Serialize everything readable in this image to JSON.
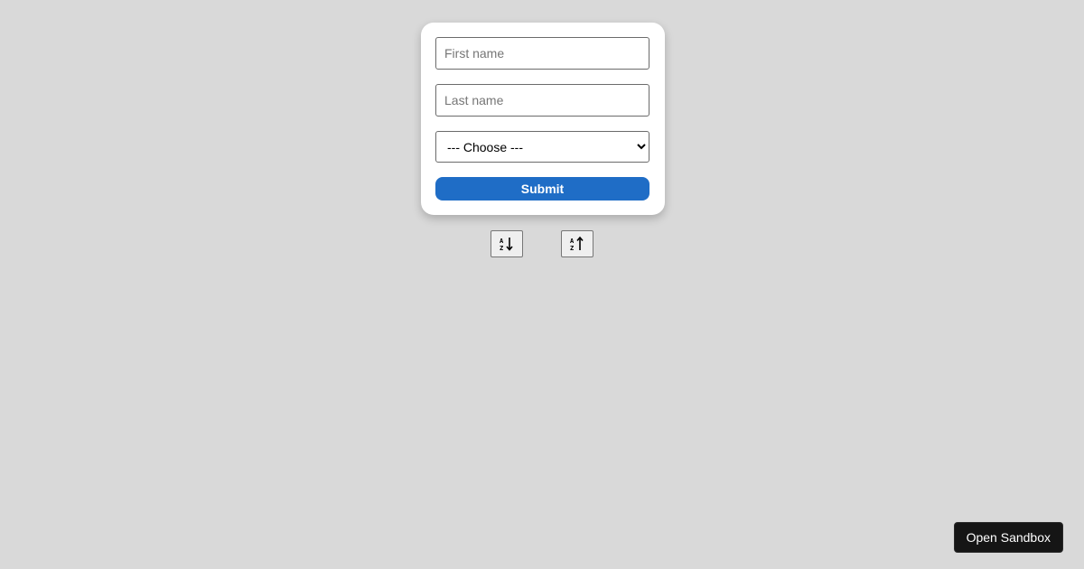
{
  "form": {
    "first_name": {
      "value": "",
      "placeholder": "First name"
    },
    "last_name": {
      "value": "",
      "placeholder": "Last name"
    },
    "select": {
      "selected": "--- Choose ---"
    },
    "submit_label": "Submit"
  },
  "sort_buttons": [
    {
      "icon": "sort-alpha-down-icon"
    },
    {
      "icon": "sort-alpha-up-icon"
    }
  ],
  "sandbox": {
    "label": "Open Sandbox"
  },
  "colors": {
    "page_background": "#d9d9d9",
    "card_background": "#ffffff",
    "submit_background": "#1f6dc6",
    "sandbox_background": "#151515"
  }
}
